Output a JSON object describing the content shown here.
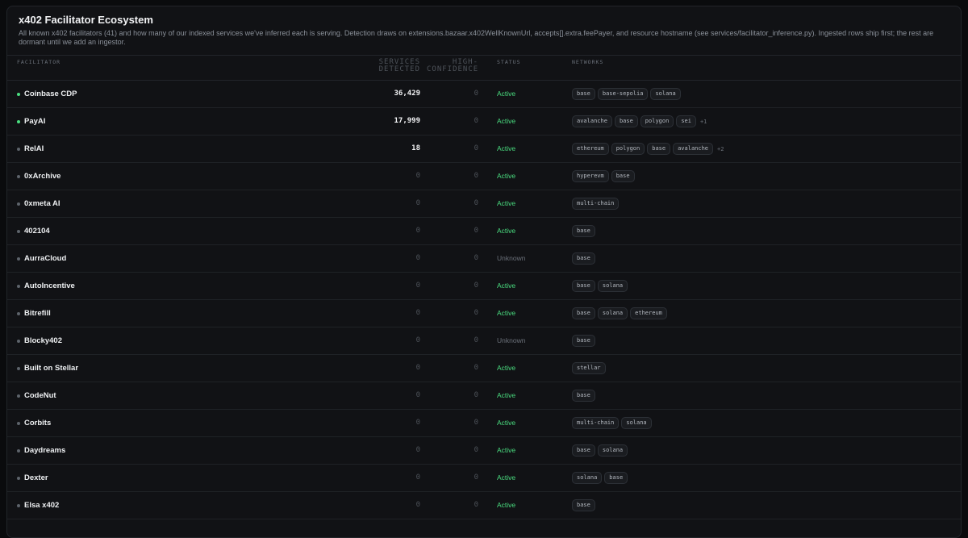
{
  "header": {
    "title": "x402 Facilitator Ecosystem",
    "description": "All known x402 facilitators (41) and how many of our indexed services we've inferred each is serving. Detection draws on extensions.bazaar.x402WellKnownUrl, accepts[].extra.feePayer, and resource hostname (see services/facilitator_inference.py). Ingested rows ship first; the rest are dormant until we add an ingestor."
  },
  "columns": {
    "facilitator": "FACILITATOR",
    "services_line1": "SERVICES",
    "services_line2": "DETECTED",
    "high_line1": "HIGH-",
    "high_line2": "CONFIDENCE",
    "status": "STATUS",
    "networks": "NETWORKS"
  },
  "rows": [
    {
      "name": "Coinbase CDP",
      "services": "36,429",
      "high": "0",
      "status": "Active",
      "networks": [
        "base",
        "base-sepolia",
        "solana"
      ],
      "more": "",
      "live": true
    },
    {
      "name": "PayAI",
      "services": "17,999",
      "high": "0",
      "status": "Active",
      "networks": [
        "avalanche",
        "base",
        "polygon",
        "sei"
      ],
      "more": "+1",
      "live": true
    },
    {
      "name": "RelAI",
      "services": "18",
      "high": "0",
      "status": "Active",
      "networks": [
        "ethereum",
        "polygon",
        "base",
        "avalanche"
      ],
      "more": "+2",
      "live": false
    },
    {
      "name": "0xArchive",
      "services": "0",
      "high": "0",
      "status": "Active",
      "networks": [
        "hyperevm",
        "base"
      ],
      "more": "",
      "live": false
    },
    {
      "name": "0xmeta AI",
      "services": "0",
      "high": "0",
      "status": "Active",
      "networks": [
        "multi-chain"
      ],
      "more": "",
      "live": false
    },
    {
      "name": "402104",
      "services": "0",
      "high": "0",
      "status": "Active",
      "networks": [
        "base"
      ],
      "more": "",
      "live": false
    },
    {
      "name": "AurraCloud",
      "services": "0",
      "high": "0",
      "status": "Unknown",
      "networks": [
        "base"
      ],
      "more": "",
      "live": false
    },
    {
      "name": "AutoIncentive",
      "services": "0",
      "high": "0",
      "status": "Active",
      "networks": [
        "base",
        "solana"
      ],
      "more": "",
      "live": false
    },
    {
      "name": "Bitrefill",
      "services": "0",
      "high": "0",
      "status": "Active",
      "networks": [
        "base",
        "solana",
        "ethereum"
      ],
      "more": "",
      "live": false
    },
    {
      "name": "Blocky402",
      "services": "0",
      "high": "0",
      "status": "Unknown",
      "networks": [
        "base"
      ],
      "more": "",
      "live": false
    },
    {
      "name": "Built on Stellar",
      "services": "0",
      "high": "0",
      "status": "Active",
      "networks": [
        "stellar"
      ],
      "more": "",
      "live": false
    },
    {
      "name": "CodeNut",
      "services": "0",
      "high": "0",
      "status": "Active",
      "networks": [
        "base"
      ],
      "more": "",
      "live": false
    },
    {
      "name": "Corbits",
      "services": "0",
      "high": "0",
      "status": "Active",
      "networks": [
        "multi-chain",
        "solana"
      ],
      "more": "",
      "live": false
    },
    {
      "name": "Daydreams",
      "services": "0",
      "high": "0",
      "status": "Active",
      "networks": [
        "base",
        "solana"
      ],
      "more": "",
      "live": false
    },
    {
      "name": "Dexter",
      "services": "0",
      "high": "0",
      "status": "Active",
      "networks": [
        "solana",
        "base"
      ],
      "more": "",
      "live": false
    },
    {
      "name": "Elsa x402",
      "services": "0",
      "high": "0",
      "status": "Active",
      "networks": [
        "base"
      ],
      "more": "",
      "live": false
    }
  ],
  "colors": {
    "active": "#4ade80",
    "unknown": "#6b717a",
    "live_dot": "#4ade80",
    "idle_dot": "#5d636b"
  }
}
